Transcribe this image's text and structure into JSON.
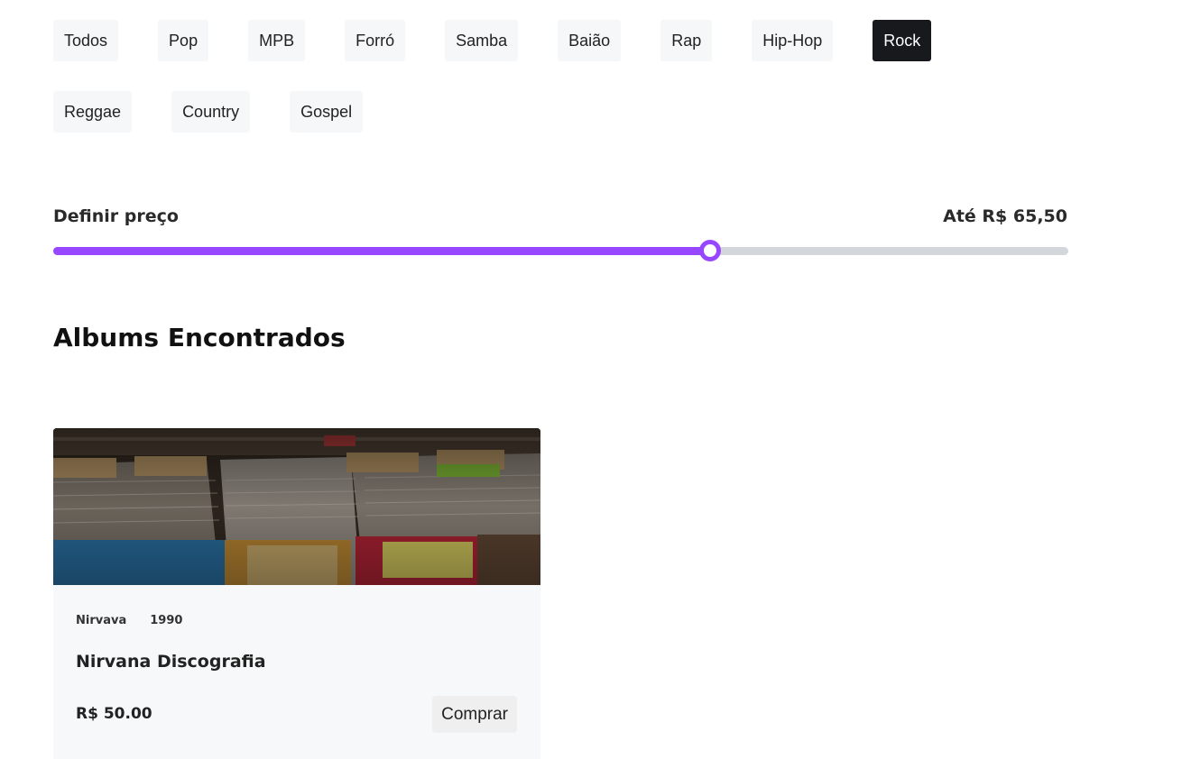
{
  "filters": {
    "genres": [
      "Todos",
      "Pop",
      "MPB",
      "Forró",
      "Samba",
      "Baião",
      "Rap",
      "Hip-Hop",
      "Rock",
      "Reggae",
      "Country",
      "Gospel"
    ],
    "active_genre": "Rock"
  },
  "price": {
    "label": "Definir preço",
    "value_text": "Até R$ 65,50",
    "slider_fraction": 0.647
  },
  "results": {
    "title": "Albums Encontrados",
    "albums": [
      {
        "artist": "Nirvava",
        "year": "1990",
        "title": "Nirvana Discografia",
        "price": "R$ 50.00",
        "buy_label": "Comprar"
      }
    ]
  },
  "colors": {
    "accent": "#9747ff",
    "active_chip": "#17191c",
    "chip": "#f6f7f9",
    "track": "#d3d6db"
  }
}
